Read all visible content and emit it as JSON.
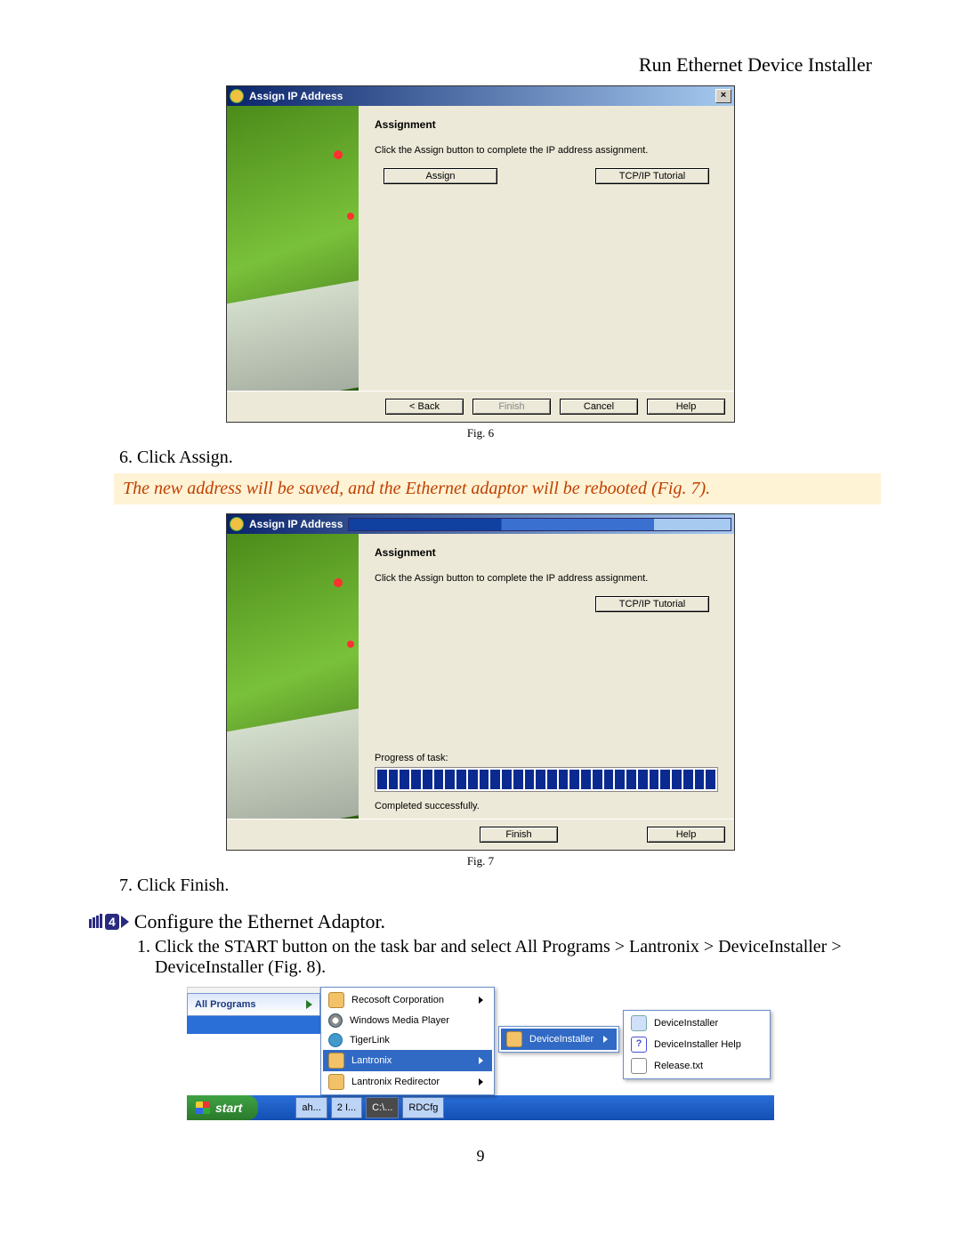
{
  "page": {
    "header": "Run Ethernet Device Installer",
    "number": "9"
  },
  "dialog1": {
    "title": "Assign IP Address",
    "close": "×",
    "section_title": "Assignment",
    "section_desc": "Click the Assign button to complete the IP address assignment.",
    "assign": "Assign",
    "tcpip": "TCP/IP Tutorial",
    "back": "< Back",
    "finish": "Finish",
    "cancel": "Cancel",
    "help": "Help",
    "caption": "Fig. 6"
  },
  "step6": "6.  Click Assign.",
  "note": "The new address will be saved, and the Ethernet adaptor will be rebooted (Fig. 7).",
  "dialog2": {
    "title": "Assign IP Address",
    "section_title": "Assignment",
    "section_desc": "Click the Assign button to complete the IP address assignment.",
    "tcpip": "TCP/IP Tutorial",
    "progress_label": "Progress of task:",
    "status": "Completed successfully.",
    "finish": "Finish",
    "help": "Help",
    "caption": "Fig. 7"
  },
  "step7": "7.  Click Finish.",
  "section4_num": "4",
  "section4_title": "Configure the Ethernet Adaptor.",
  "step41": "1.  Click the START button on the task bar and select All Programs > Lantronix > DeviceInstaller > DeviceInstaller (Fig. 8).",
  "startmenu": {
    "all_programs": "All Programs",
    "start": "start",
    "col1": {
      "recosoft": "Recosoft Corporation",
      "wmp": "Windows Media Player",
      "tigerlink": "TigerLink",
      "lantronix": "Lantronix",
      "redirector": "Lantronix Redirector"
    },
    "col2": {
      "device_installer": "DeviceInstaller"
    },
    "col3": {
      "device_installer": "DeviceInstaller",
      "help": "DeviceInstaller Help",
      "release": "Release.txt"
    },
    "task": {
      "a": "ah...",
      "b": "2 I...",
      "c": "C:\\...",
      "d": "RDCfg"
    }
  }
}
